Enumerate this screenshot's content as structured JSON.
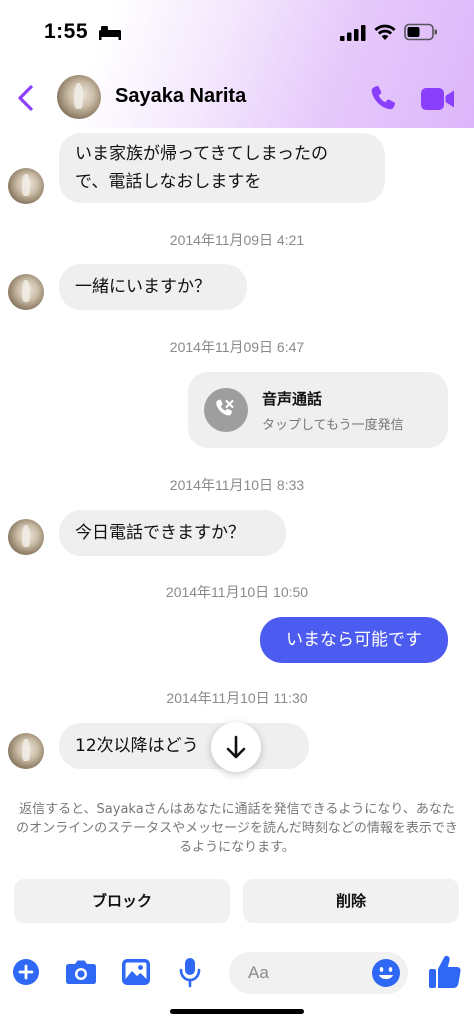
{
  "status_bar": {
    "time": "1:55"
  },
  "header": {
    "contact_name": "Sayaka Narita"
  },
  "messages": [
    {
      "type": "incoming",
      "lines": [
        "いま家族が帰ってきてしまったの",
        "で、電話しなおしますを"
      ]
    },
    {
      "type": "timestamp",
      "text": "2014年11月09日 4:21"
    },
    {
      "type": "incoming",
      "text": "一緒にいますか？"
    },
    {
      "type": "timestamp",
      "text": "2014年11月09日 6:47"
    },
    {
      "type": "call",
      "title": "音声通話",
      "subtitle": "タップしてもう一度発信"
    },
    {
      "type": "timestamp",
      "text": "2014年11月10日 8:33"
    },
    {
      "type": "incoming",
      "text": "今日電話できますか？"
    },
    {
      "type": "timestamp",
      "text": "2014年11月10日 10:50"
    },
    {
      "type": "outgoing",
      "text": "いまなら可能です"
    },
    {
      "type": "timestamp",
      "text": "2014年11月10日 11:30"
    },
    {
      "type": "incoming",
      "text": "12次以降はどう　　か？"
    }
  ],
  "notice": {
    "text": "返信すると、Sayakaさんはあなたに通話を発信できるようになり、あなたのオンラインのステータスやメッセージを読んだ時刻などの情報を表示できるようになります。"
  },
  "actions": {
    "block_label": "ブロック",
    "delete_label": "削除"
  },
  "composer": {
    "placeholder": "Aa"
  },
  "colors": {
    "accent": "#8a3ffc",
    "outgoing_bubble": "#4d5cf0",
    "composer_icon": "#2f68f5",
    "incoming_bubble": "#efefef"
  },
  "icons": [
    "back-icon",
    "phone-icon",
    "video-icon",
    "missed-call-icon",
    "arrow-down-icon",
    "plus-icon",
    "camera-icon",
    "image-icon",
    "microphone-icon",
    "emoji-icon",
    "thumbs-up-icon"
  ]
}
